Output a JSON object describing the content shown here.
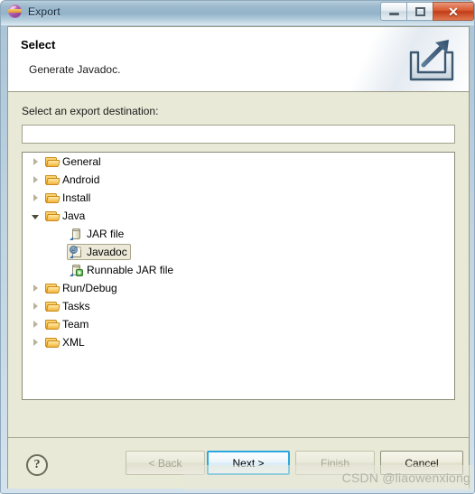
{
  "window": {
    "title": "Export",
    "title_icon": "eclipse-globe-icon",
    "ghost_text": "",
    "controls": {
      "minimize": "minimize-icon",
      "maximize": "maximize-icon",
      "close": "✕"
    }
  },
  "header": {
    "title": "Select",
    "description": "Generate Javadoc.",
    "banner_icon": "export-arrow-tray-icon"
  },
  "content": {
    "destination_label": "Select an export destination:",
    "filter": {
      "value": "",
      "placeholder": ""
    },
    "tree": [
      {
        "label": "General",
        "icon": "folder-icon",
        "indent": 0,
        "state": "collapsed",
        "selected": false
      },
      {
        "label": "Android",
        "icon": "folder-icon",
        "indent": 0,
        "state": "collapsed",
        "selected": false
      },
      {
        "label": "Install",
        "icon": "folder-icon",
        "indent": 0,
        "state": "collapsed",
        "selected": false
      },
      {
        "label": "Java",
        "icon": "folder-icon",
        "indent": 0,
        "state": "expanded",
        "selected": false
      },
      {
        "label": "JAR file",
        "icon": "jar-icon",
        "indent": 1,
        "state": "leaf",
        "selected": false
      },
      {
        "label": "Javadoc",
        "icon": "javadoc-icon",
        "indent": 1,
        "state": "leaf",
        "selected": true
      },
      {
        "label": "Runnable JAR file",
        "icon": "runnable-jar-icon",
        "indent": 1,
        "state": "leaf",
        "selected": false
      },
      {
        "label": "Run/Debug",
        "icon": "folder-icon",
        "indent": 0,
        "state": "collapsed",
        "selected": false
      },
      {
        "label": "Tasks",
        "icon": "folder-icon",
        "indent": 0,
        "state": "collapsed",
        "selected": false
      },
      {
        "label": "Team",
        "icon": "folder-icon",
        "indent": 0,
        "state": "collapsed",
        "selected": false
      },
      {
        "label": "XML",
        "icon": "folder-icon",
        "indent": 0,
        "state": "collapsed",
        "selected": false
      }
    ]
  },
  "footer": {
    "help_label": "?",
    "buttons": {
      "back": "< Back",
      "next": "Next >",
      "finish": "Finish",
      "cancel": "Cancel"
    }
  },
  "watermark": "CSDN @liaowenxiong",
  "colors": {
    "dialog_background": "#e9e9d7",
    "header_background": "#ffffff",
    "tree_background": "#ffffff",
    "default_button_border": "#2aa8e0",
    "close_button": "#d8582f",
    "folder_icon": "#efa827"
  }
}
